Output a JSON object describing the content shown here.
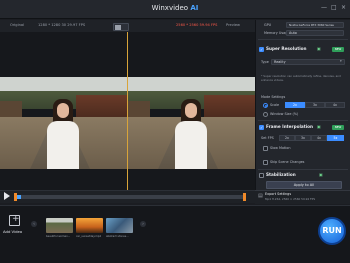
{
  "window": {
    "title_main": "Winxvideo",
    "title_ai": "AI",
    "controls": [
      "—",
      "□",
      "×"
    ]
  },
  "preview_header": {
    "original_label": "Original",
    "original_info": "1280 * 1280 30 29.97 FPS",
    "output_info": "2560 * 2560 59.94 FPS",
    "preview_label": "Preview"
  },
  "timeline": {
    "progress_fraction": 0.03
  },
  "panel": {
    "gpu_label": "GPU",
    "gpu_value": "Nvidia GeForce RTX 3060 Series",
    "memory_label": "Memory Usage",
    "memory_value": "Auto",
    "super_resolution": {
      "title": "Super Resolution",
      "tag": "NEW",
      "type_label": "Type",
      "type_value": "Reality",
      "note": "* Super resolution can automatically refine, denoise, and enhance videos.",
      "mode_label": "Mode Settings",
      "scale_label": "Scale",
      "scale_options": [
        "2x",
        "3x",
        "4x"
      ],
      "scale_selected": 0,
      "window_size_label": "Window Size (%)"
    },
    "frame_interpolation": {
      "title": "Frame Interpolation",
      "tag": "NEW",
      "fps_label": "Set FPS",
      "fps_options": [
        "2x",
        "3x",
        "4x",
        "5x"
      ],
      "fps_selected": 3,
      "slow_motion_label": "Slow Motion",
      "skip_scene_label": "Skip Scene Changes"
    },
    "stabilization": {
      "title": "Stabilization"
    },
    "apply_label": "Apply to All"
  },
  "export": {
    "title": "Export Settings",
    "info": "Mp4 H.264, 2560 × 2560 59.94 FPS"
  },
  "bottom": {
    "add_video_label": "Add Video",
    "clips": [
      {
        "label": "beautiful woman..."
      },
      {
        "label": "car_sunsetday.mp4"
      },
      {
        "label": "abstract stones..."
      }
    ],
    "run_label": "RUN"
  }
}
